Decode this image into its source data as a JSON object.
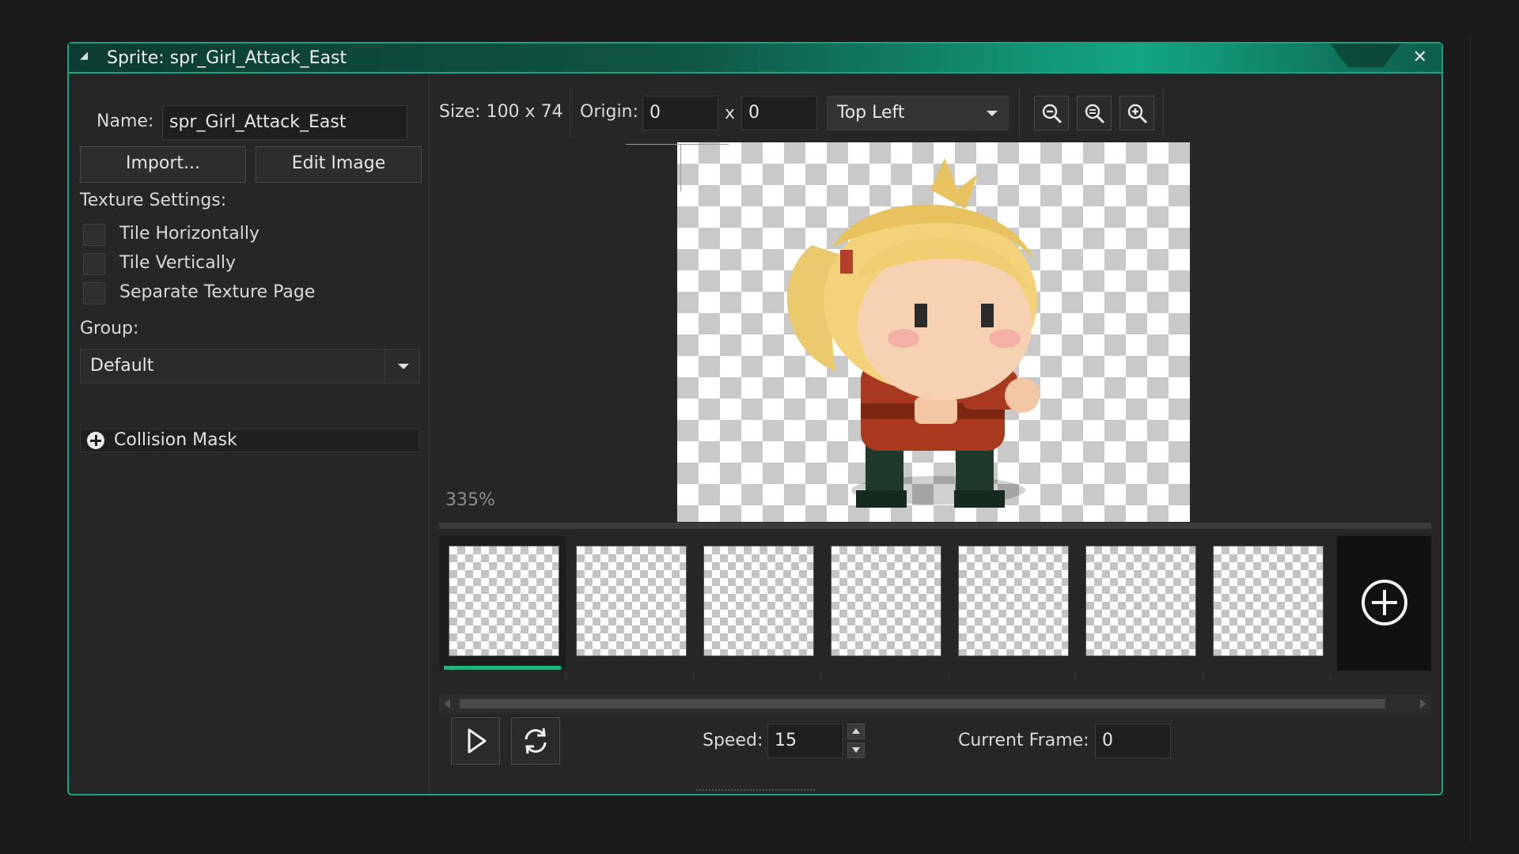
{
  "window": {
    "title": "Sprite: spr_Girl_Attack_East",
    "close_glyph": "✕",
    "collapse_glyph": "◢"
  },
  "left": {
    "name_label": "Name:",
    "name_value": "spr_Girl_Attack_East",
    "import_label": "Import...",
    "edit_image_label": "Edit Image",
    "texture_settings_label": "Texture Settings:",
    "tile_horizontally": {
      "label": "Tile Horizontally",
      "checked": false
    },
    "tile_vertically": {
      "label": "Tile Vertically",
      "checked": false
    },
    "separate_texture_page": {
      "label": "Separate Texture Page",
      "checked": false
    },
    "group_label": "Group:",
    "group_value": "Default",
    "collision_mask_label": "Collision Mask"
  },
  "toolbar": {
    "size_text": "Size: 100 x 74",
    "origin_label": "Origin:",
    "origin_x": "0",
    "origin_x_sep": "x",
    "origin_y": "0",
    "origin_preset": "Top Left"
  },
  "icons": {
    "zoom_out": "zoom-out-icon",
    "zoom_reset": "zoom-reset-icon",
    "zoom_in": "zoom-in-icon",
    "play": "play-icon",
    "loop": "loop-icon",
    "add_frame": "add-frame-icon",
    "collision_expand": "plus-icon"
  },
  "canvas": {
    "zoom_level": "335%"
  },
  "frames": {
    "count": 7,
    "selected_index": 0
  },
  "playback": {
    "speed_label": "Speed:",
    "speed_value": "15",
    "current_frame_label": "Current Frame:",
    "current_frame_value": "0"
  },
  "colors": {
    "accent": "#1aa37f",
    "active_frame": "#1fb27c",
    "background": "#262627"
  }
}
